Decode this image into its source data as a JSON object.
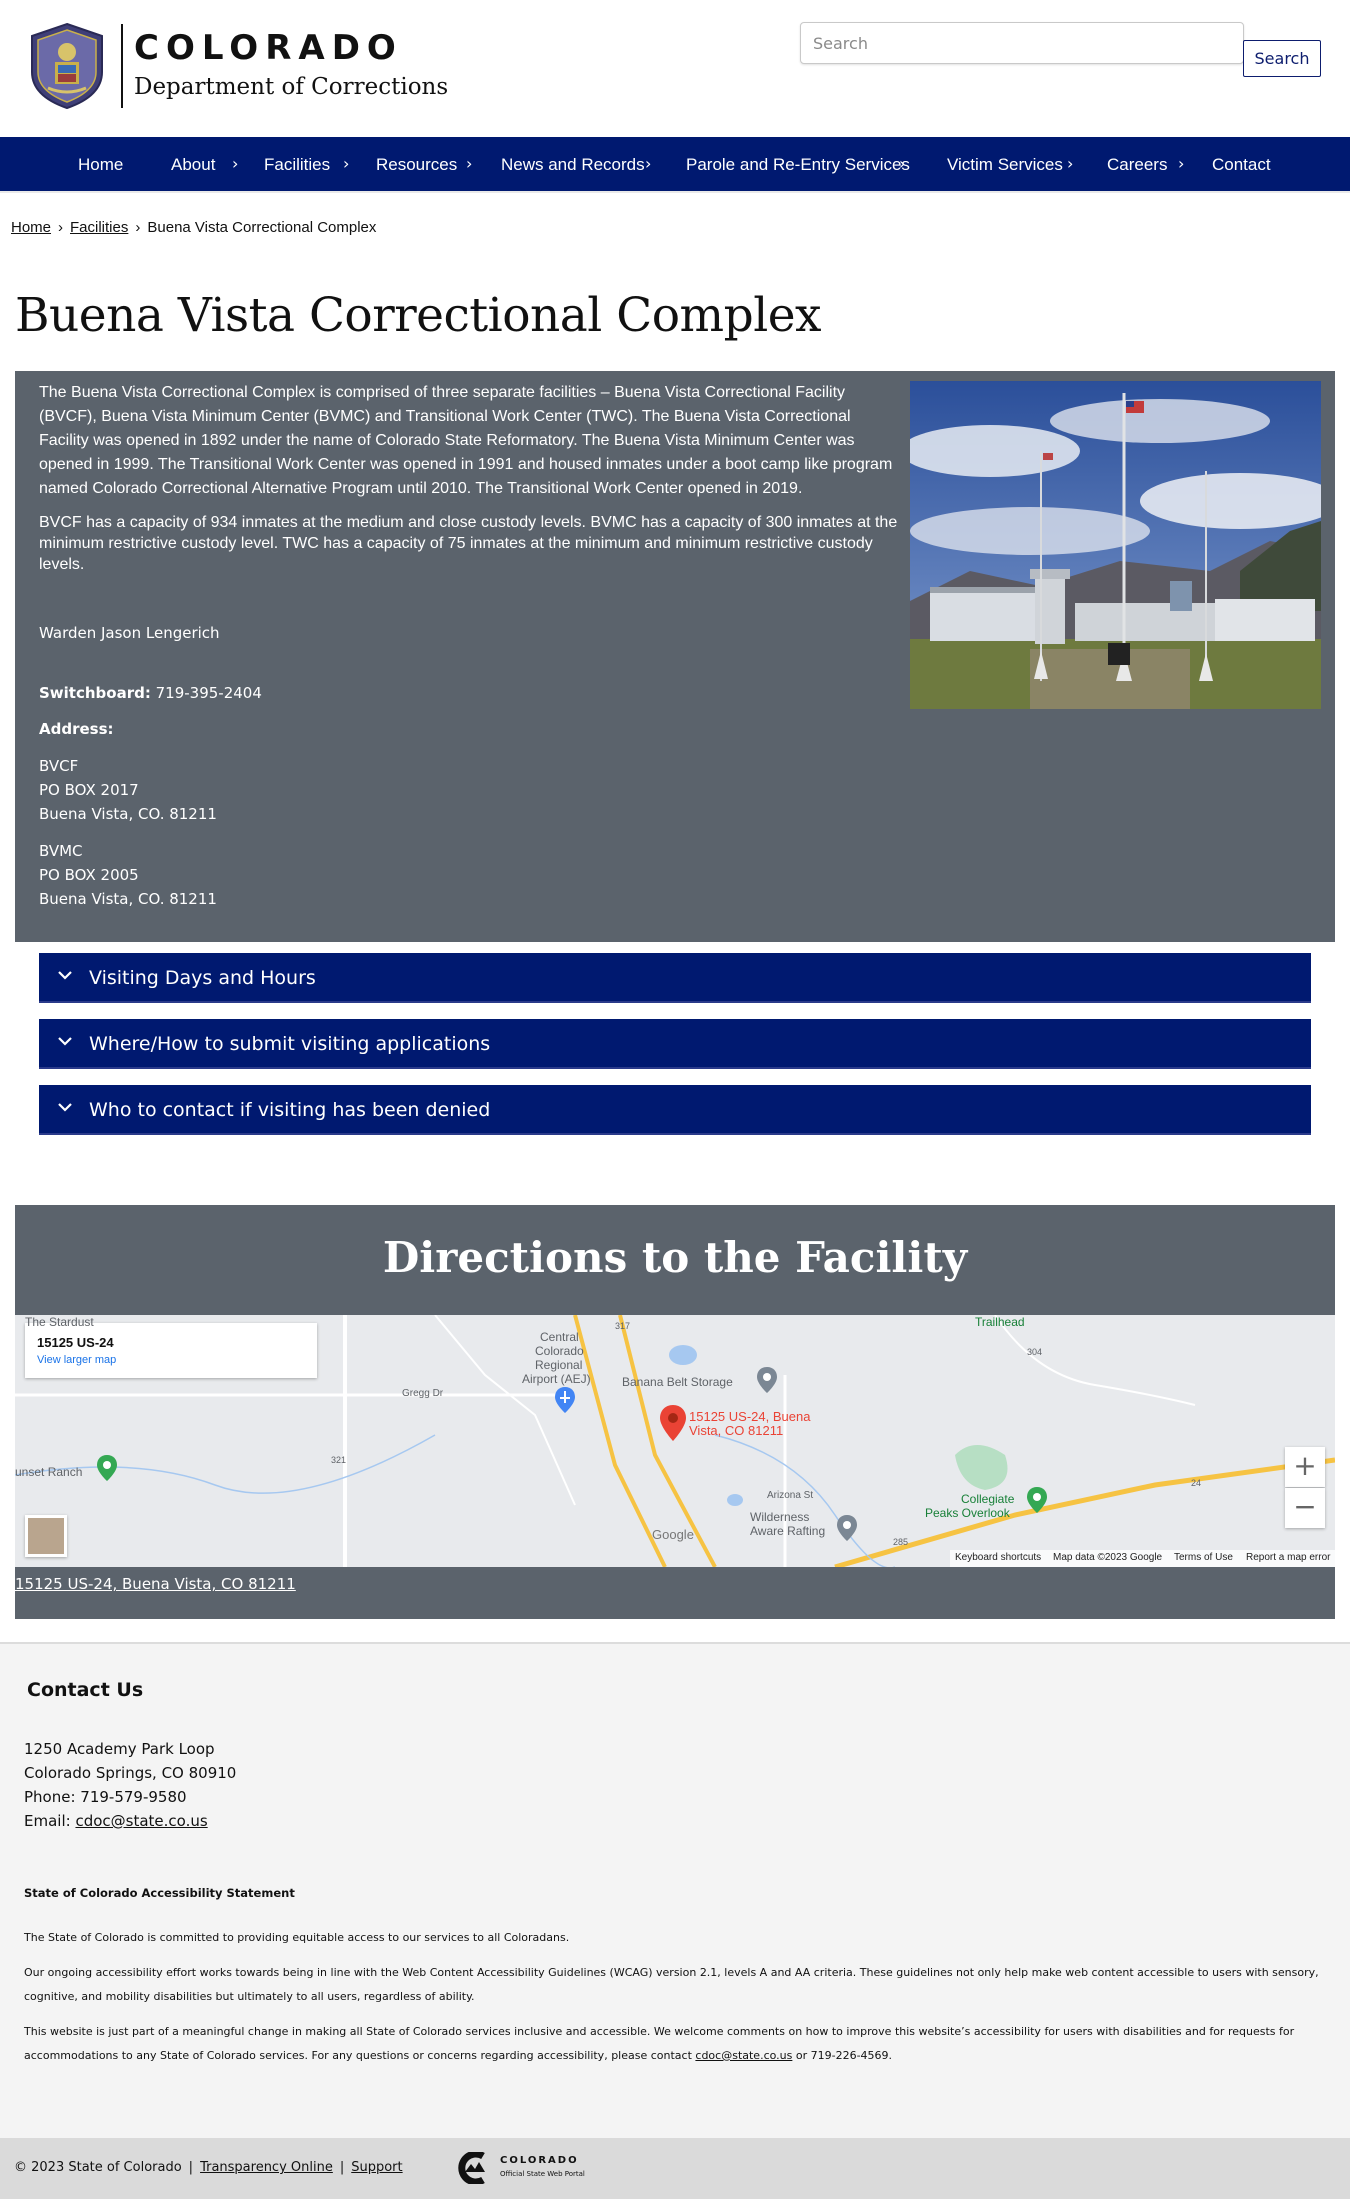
{
  "header": {
    "brand_state": "COLORADO",
    "brand_department": "Department of Corrections",
    "search_placeholder": "Search",
    "search_button": "Search"
  },
  "nav": {
    "items": [
      {
        "label": "Home",
        "has_submenu": false
      },
      {
        "label": "About",
        "has_submenu": true
      },
      {
        "label": "Facilities",
        "has_submenu": true
      },
      {
        "label": "Resources",
        "has_submenu": true
      },
      {
        "label": "News and Records",
        "has_submenu": true
      },
      {
        "label": "Parole and Re-Entry Services",
        "has_submenu": true
      },
      {
        "label": "Victim Services",
        "has_submenu": true
      },
      {
        "label": "Careers",
        "has_submenu": true
      },
      {
        "label": "Contact",
        "has_submenu": false
      }
    ],
    "background": "#001970"
  },
  "breadcrumb": {
    "items": [
      "Home",
      "Facilities"
    ],
    "current": "Buena Vista Correctional Complex"
  },
  "page": {
    "title": "Buena Vista Correctional Complex"
  },
  "info": {
    "paragraph_1": "The Buena Vista Correctional Complex is comprised of three separate facilities – Buena Vista Correctional Facility (BVCF), Buena Vista Minimum Center (BVMC) and Transitional Work Center (TWC). The Buena Vista Correctional Facility was opened in 1892 under the name of Colorado State Reformatory. The Buena Vista Minimum Center was opened in 1999. The Transitional Work Center was opened in 1991 and housed inmates under a boot camp like program named Colorado Correctional Alternative Program until 2010. The Transitional Work Center opened in 2019.",
    "paragraph_2": "BVCF has a capacity of 934 inmates at the medium and close custody levels. BVMC has a capacity of 300 inmates at the minimum restrictive custody level. TWC has a capacity of 75 inmates at the minimum and minimum restrictive custody levels.",
    "warden": "Warden Jason Lengerich",
    "switchboard_label": "Switchboard:",
    "switchboard_value": "719-395-2404",
    "address_label": "Address:",
    "address_1": [
      "BVCF",
      "PO BOX 2017",
      "Buena Vista, CO. 81211"
    ],
    "address_2": [
      "BVMC",
      "PO BOX 2005",
      "Buena Vista, CO. 81211"
    ],
    "panel_color": "#5b636c"
  },
  "accordions": [
    "Visiting Days and Hours",
    "Where/How to submit visiting applications",
    "Who to contact if visiting has been denied"
  ],
  "directions": {
    "title": "Directions to the Facility",
    "address_link": "15125 US-24, Buena Vista, CO 81211",
    "map": {
      "card_title": "15125 US-24",
      "card_link": "View larger map",
      "pin_label_1": "15125 US-24, Buena",
      "pin_label_2": "Vista, CO 81211",
      "labels": {
        "stardust": "The Stardust",
        "airport_1": "Central",
        "airport_2": "Colorado",
        "airport_3": "Regional",
        "airport_4": "Airport (AEJ)",
        "storage": "Banana Belt Storage",
        "gregg": "Gregg Dr",
        "ranch": "unset Ranch",
        "wilderness_1": "Wilderness",
        "wilderness_2": "Aware Rafting",
        "collegiate_1": "Collegiate",
        "collegiate_2": "Peaks Overlook",
        "arizona": "Arizona St",
        "trailhead": "Trailhead",
        "shield_317": "317",
        "shield_304": "304",
        "shield_321": "321",
        "shield_24": "24",
        "shield_285": "285",
        "google": "Google"
      },
      "zoom_in": "+",
      "zoom_out": "−",
      "footer": [
        "Keyboard shortcuts",
        "Map data ©2023 Google",
        "Terms of Use",
        "Report a map error"
      ]
    }
  },
  "footer": {
    "contact_heading": "Contact Us",
    "street": "1250 Academy Park Loop",
    "city": "Colorado Springs, CO 80910",
    "phone": "Phone: 719-579-9580",
    "email_label": "Email:",
    "email": "cdoc@state.co.us",
    "accessibility_heading": "State of Colorado Accessibility Statement",
    "accessibility_p1": "The State of Colorado is committed to providing equitable access to our services to all Coloradans.",
    "accessibility_p2": "Our ongoing accessibility effort works towards being in line with the Web Content Accessibility Guidelines (WCAG) version 2.1, levels A and AA criteria. These guidelines not only help make web content accessible to users with sensory, cognitive, and mobility disabilities but ultimately to all users, regardless of ability.",
    "accessibility_p3_before": "This website is just part of a meaningful change in making all State of Colorado services inclusive and accessible. We welcome comments on how to improve this website’s accessibility for users with disabilities and for requests for accommodations to any State of Colorado services. For any questions or concerns regarding accessibility, please contact",
    "accessibility_p3_email": "cdoc@state.co.us",
    "accessibility_p3_after": "or 719-226-4569.",
    "copyright": "© 2023 State of Colorado",
    "transparency": "Transparency Online",
    "support": "Support",
    "portal_name": "COLORADO",
    "portal_sub": "Official State Web Portal"
  }
}
